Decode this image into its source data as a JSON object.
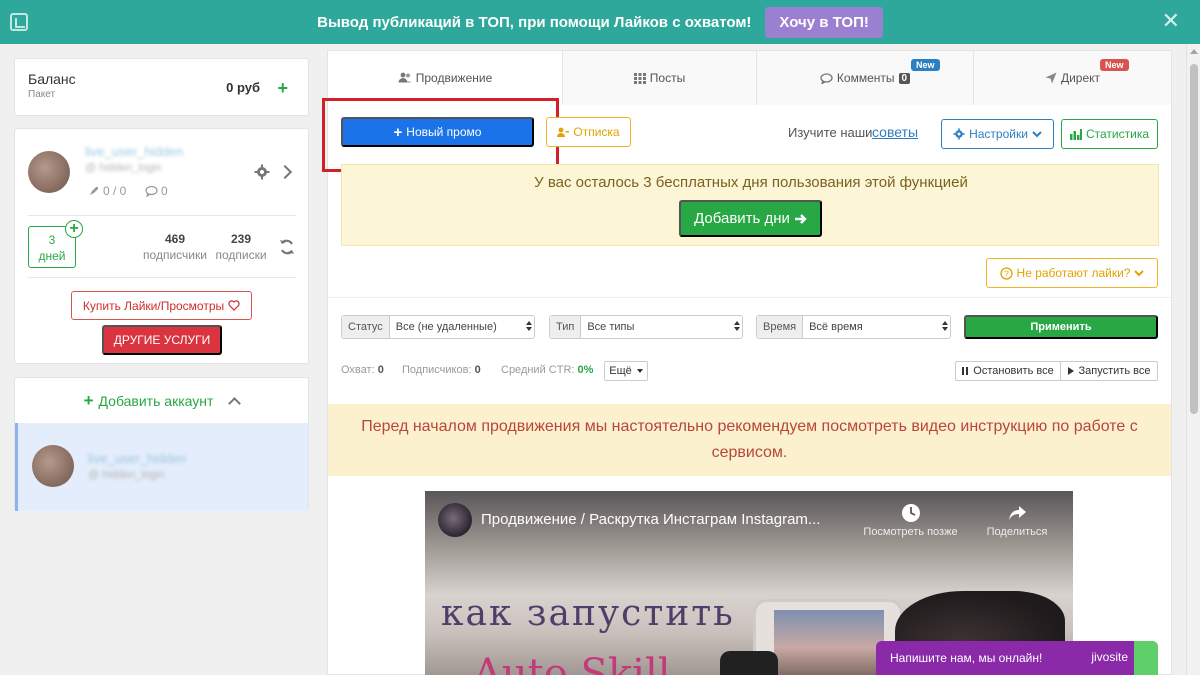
{
  "banner": {
    "text": "Вывод публикаций в ТОП, при помощи Лайков с охватом!",
    "cta": "Хочу в ТОП!",
    "close": "✕"
  },
  "balance": {
    "label": "Баланс",
    "sub": "Пакет",
    "value": "0 руб"
  },
  "account": {
    "name": "live_user_hidden",
    "handle": "@ hidden_login",
    "promos": "0 / 0",
    "comments": "0",
    "days_num": "3",
    "days_label": "дней",
    "followers_num": "469",
    "followers_label": "подписчики",
    "following_num": "239",
    "following_label": "подписки",
    "buy_btn": "Купить Лайки/Просмотры",
    "other_btn": "ДРУГИЕ УСЛУГИ"
  },
  "add_account": {
    "label": "Добавить аккаунт",
    "item_name": "live_user_hidden",
    "item_handle": "@ hidden_login"
  },
  "tabs": [
    {
      "label": "Продвижение",
      "icon": "users-icon"
    },
    {
      "label": "Посты",
      "icon": "grid-icon"
    },
    {
      "label": "Комменты",
      "icon": "comment-icon",
      "count": "0",
      "badge": "New"
    },
    {
      "label": "Директ",
      "icon": "send-icon",
      "badge": "New"
    }
  ],
  "toolbar": {
    "new_promo": "Новый промо",
    "unsubscribe": "Отписка",
    "learn_text": "Изучите наши",
    "learn_link": "советы",
    "settings": "Настройки",
    "stats": "Статистика"
  },
  "trial": {
    "text": "У вас осталось 3 бесплатных дня пользования этой функцией",
    "btn": "Добавить дни"
  },
  "likes_help": "Не работают лайки?",
  "filters": {
    "status_label": "Статус",
    "status_value": "Все (не удаленные)",
    "type_label": "Тип",
    "type_value": "Все типы",
    "time_label": "Время",
    "time_value": "Всё время",
    "apply": "Применить"
  },
  "metrics": {
    "reach_label": "Охват:",
    "reach_value": "0",
    "subs_label": "Подписчиков:",
    "subs_value": "0",
    "ctr_label": "Средний CTR:",
    "ctr_value": "0%",
    "more": "Ещё",
    "stop_all": "Остановить все",
    "start_all": "Запустить все"
  },
  "notice": "Перед началом продвижения мы настоятельно рекомендуем посмотреть видео инструкцию по работе с сервисом.",
  "video": {
    "title": "Продвижение / Раскрутка Инстаграм Instagram...",
    "watch_later": "Посмотреть позже",
    "share": "Поделиться",
    "big_text": "как запустить",
    "big_text_2": "Auto Skill"
  },
  "chat": {
    "text": "Напишите нам, мы онлайн!",
    "brand": "jivosite"
  },
  "colors": {
    "banner": "#2ea89a",
    "accent_green": "#28a745",
    "primary_blue": "#1a73e8",
    "highlight_red": "#d0202a",
    "chat_purple": "#8a2aa8"
  }
}
